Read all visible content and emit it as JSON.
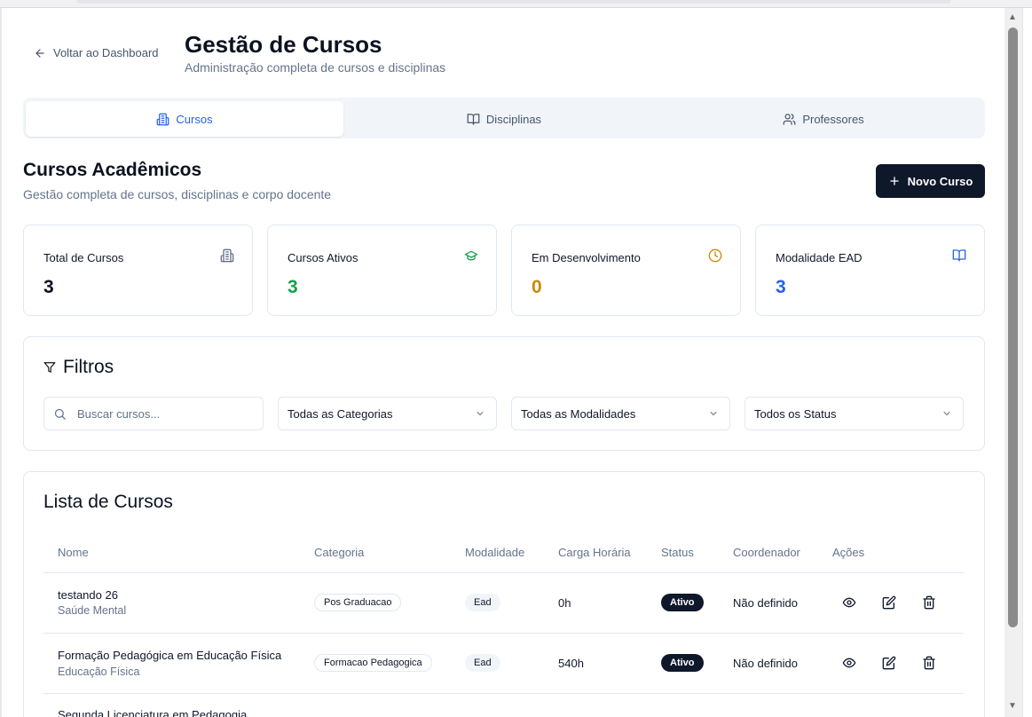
{
  "header": {
    "back_label": "Voltar ao Dashboard",
    "title": "Gestão de Cursos",
    "subtitle": "Administração completa de cursos e disciplinas"
  },
  "tabs": [
    {
      "label": "Cursos",
      "icon": "building-icon",
      "active": true
    },
    {
      "label": "Disciplinas",
      "icon": "book-icon",
      "active": false
    },
    {
      "label": "Professores",
      "icon": "users-icon",
      "active": false
    }
  ],
  "section": {
    "title": "Cursos Acadêmicos",
    "subtitle": "Gestão completa de cursos, disciplinas e corpo docente",
    "new_button": "Novo Curso"
  },
  "stats": [
    {
      "label": "Total de Cursos",
      "value": "3",
      "icon": "building-icon",
      "color": "#0b1220"
    },
    {
      "label": "Cursos Ativos",
      "value": "3",
      "icon": "graduation-cap-icon",
      "color": "#16a34a"
    },
    {
      "label": "Em Desenvolvimento",
      "value": "0",
      "icon": "clock-icon",
      "color": "#ca8a04"
    },
    {
      "label": "Modalidade EAD",
      "value": "3",
      "icon": "book-icon",
      "color": "#2563eb"
    }
  ],
  "filters": {
    "title": "Filtros",
    "search_placeholder": "Buscar cursos...",
    "category": "Todas as Categorias",
    "modality": "Todas as Modalidades",
    "status": "Todos os Status"
  },
  "list": {
    "title": "Lista de Cursos",
    "columns": [
      "Nome",
      "Categoria",
      "Modalidade",
      "Carga Horária",
      "Status",
      "Coordenador",
      "Ações"
    ],
    "rows": [
      {
        "name": "testando 26",
        "area": "Saúde Mental",
        "category": "Pos Graduacao",
        "modality": "Ead",
        "hours": "0h",
        "status": "Ativo",
        "coordinator": "Não definido"
      },
      {
        "name": "Formação Pedagógica em Educação Física",
        "area": "Educação Física",
        "category": "Formacao Pedagogica",
        "modality": "Ead",
        "hours": "540h",
        "status": "Ativo",
        "coordinator": "Não definido"
      },
      {
        "name": "Segunda Licenciatura em Pedagogia",
        "area": "",
        "category": "",
        "modality": "",
        "hours": "",
        "status": "",
        "coordinator": ""
      }
    ]
  },
  "colors": {
    "accent": "#2563eb",
    "dark": "#0f172a",
    "muted": "#64748b",
    "border": "#e2e8f0"
  }
}
